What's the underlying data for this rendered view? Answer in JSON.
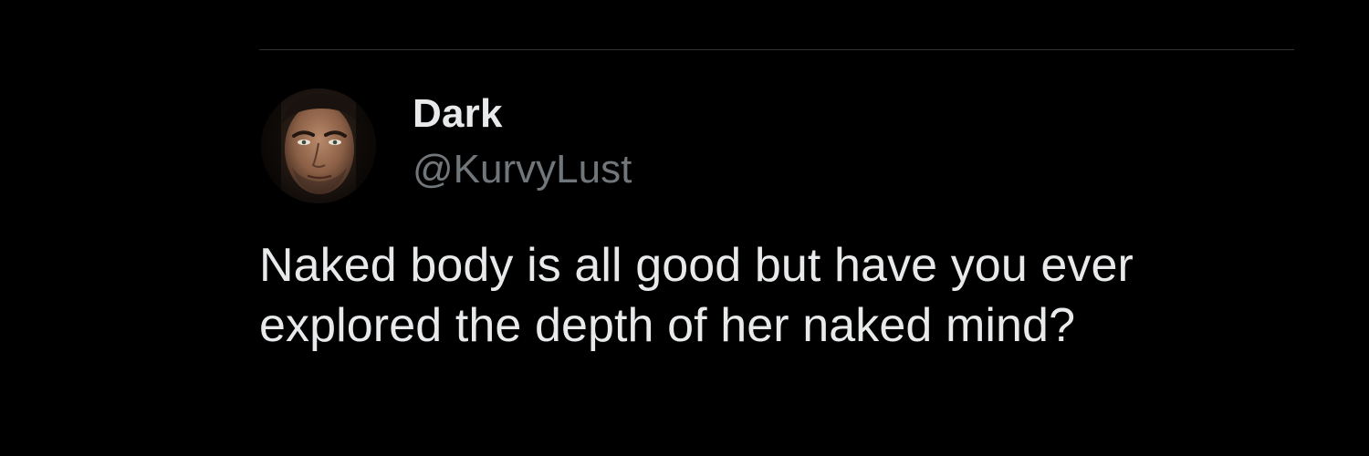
{
  "tweet": {
    "author": {
      "display_name": "Dark",
      "handle": "@KurvyLust",
      "avatar_icon": "profile-photo-man"
    },
    "text_lines": [
      "Naked body is all good but have you ever",
      "explored the depth of her naked mind?"
    ]
  },
  "colors": {
    "background": "#000000",
    "primary_text": "#e7e9ea",
    "secondary_text": "#71767b",
    "divider": "#2f3336"
  }
}
